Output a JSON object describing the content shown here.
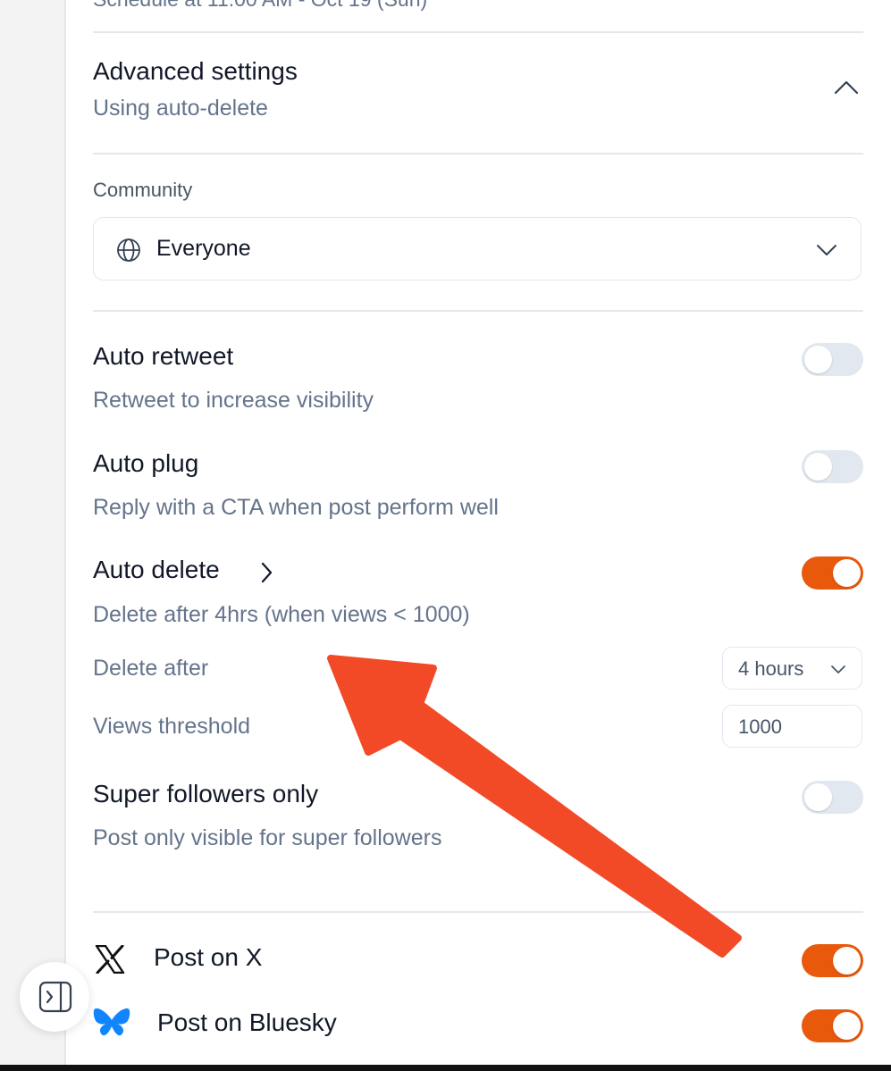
{
  "schedule": {
    "text": "Schedule at 11:00 AM - Oct 19 (Sun)"
  },
  "advanced": {
    "title": "Advanced settings",
    "subtitle": "Using auto-delete",
    "chevron_icon": "chevron-up-icon"
  },
  "community": {
    "label": "Community",
    "value": "Everyone",
    "icon": "globe-icon",
    "chevron_icon": "chevron-down-icon"
  },
  "settings": {
    "auto_retweet": {
      "title": "Auto retweet",
      "description": "Retweet to increase visibility",
      "enabled": false
    },
    "auto_plug": {
      "title": "Auto plug",
      "description": "Reply with a CTA when post perform well",
      "enabled": false
    },
    "auto_delete": {
      "title": "Auto delete",
      "description": "Delete after 4hrs (when views < 1000)",
      "enabled": true,
      "chevron_icon": "chevron-right-icon",
      "delete_after_label": "Delete after",
      "delete_after_value": "4 hours",
      "views_threshold_label": "Views threshold",
      "views_threshold_value": "1000"
    },
    "super_followers": {
      "title": "Super followers only",
      "description": "Post only visible for super followers",
      "enabled": false
    }
  },
  "platforms": {
    "x": {
      "label": "Post on X",
      "icon": "x-logo-icon",
      "enabled": true
    },
    "bluesky": {
      "label": "Post on Bluesky",
      "icon": "bluesky-butterfly-icon",
      "enabled": true
    }
  },
  "sidebar_toggle": {
    "icon": "sidebar-panel-icon"
  },
  "colors": {
    "accent": "#e8590c",
    "annotation_arrow": "#f24a26",
    "muted_text": "#64748b",
    "bluesky_blue": "#1185fe"
  }
}
